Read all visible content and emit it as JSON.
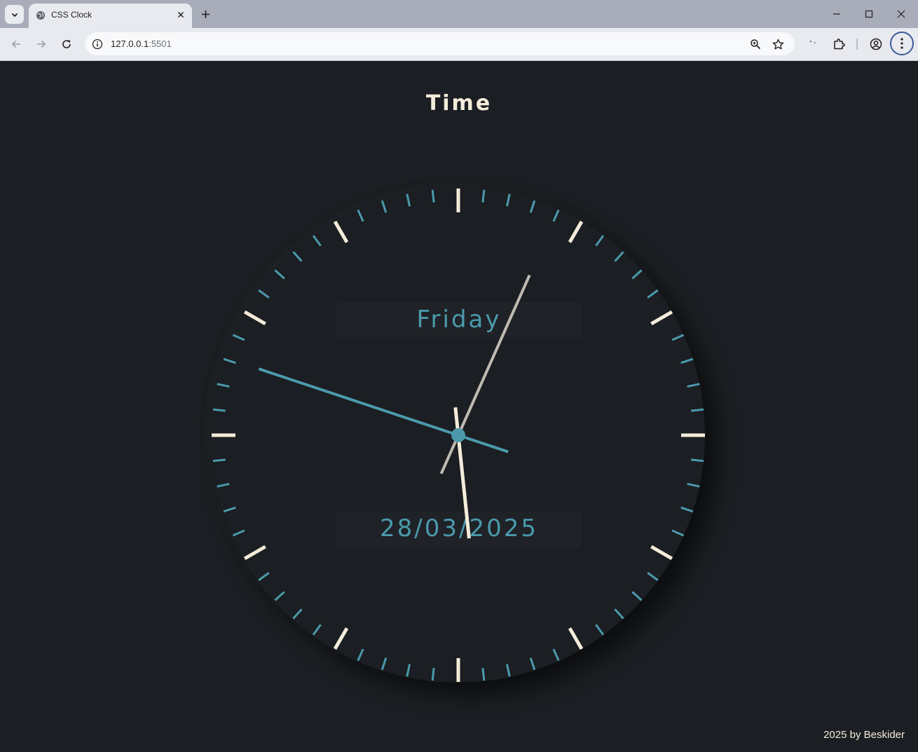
{
  "browser": {
    "tab_title": "CSS Clock",
    "url_host": "127.0.0.1",
    "url_port": ":5501"
  },
  "page": {
    "title": "Time",
    "day": "Friday",
    "date": "28/03/2025",
    "footer": "2025 by Beskider"
  },
  "clock": {
    "hour": 5,
    "minute": 48,
    "second": 4,
    "colors": {
      "major_tick": "#f3ecda",
      "minor_tick": "#4a9aac",
      "hour_hand": "#f3ecda",
      "minute_hand": "#bfbab0",
      "second_hand": "#4a9aac",
      "center": "#4a9aac"
    }
  }
}
